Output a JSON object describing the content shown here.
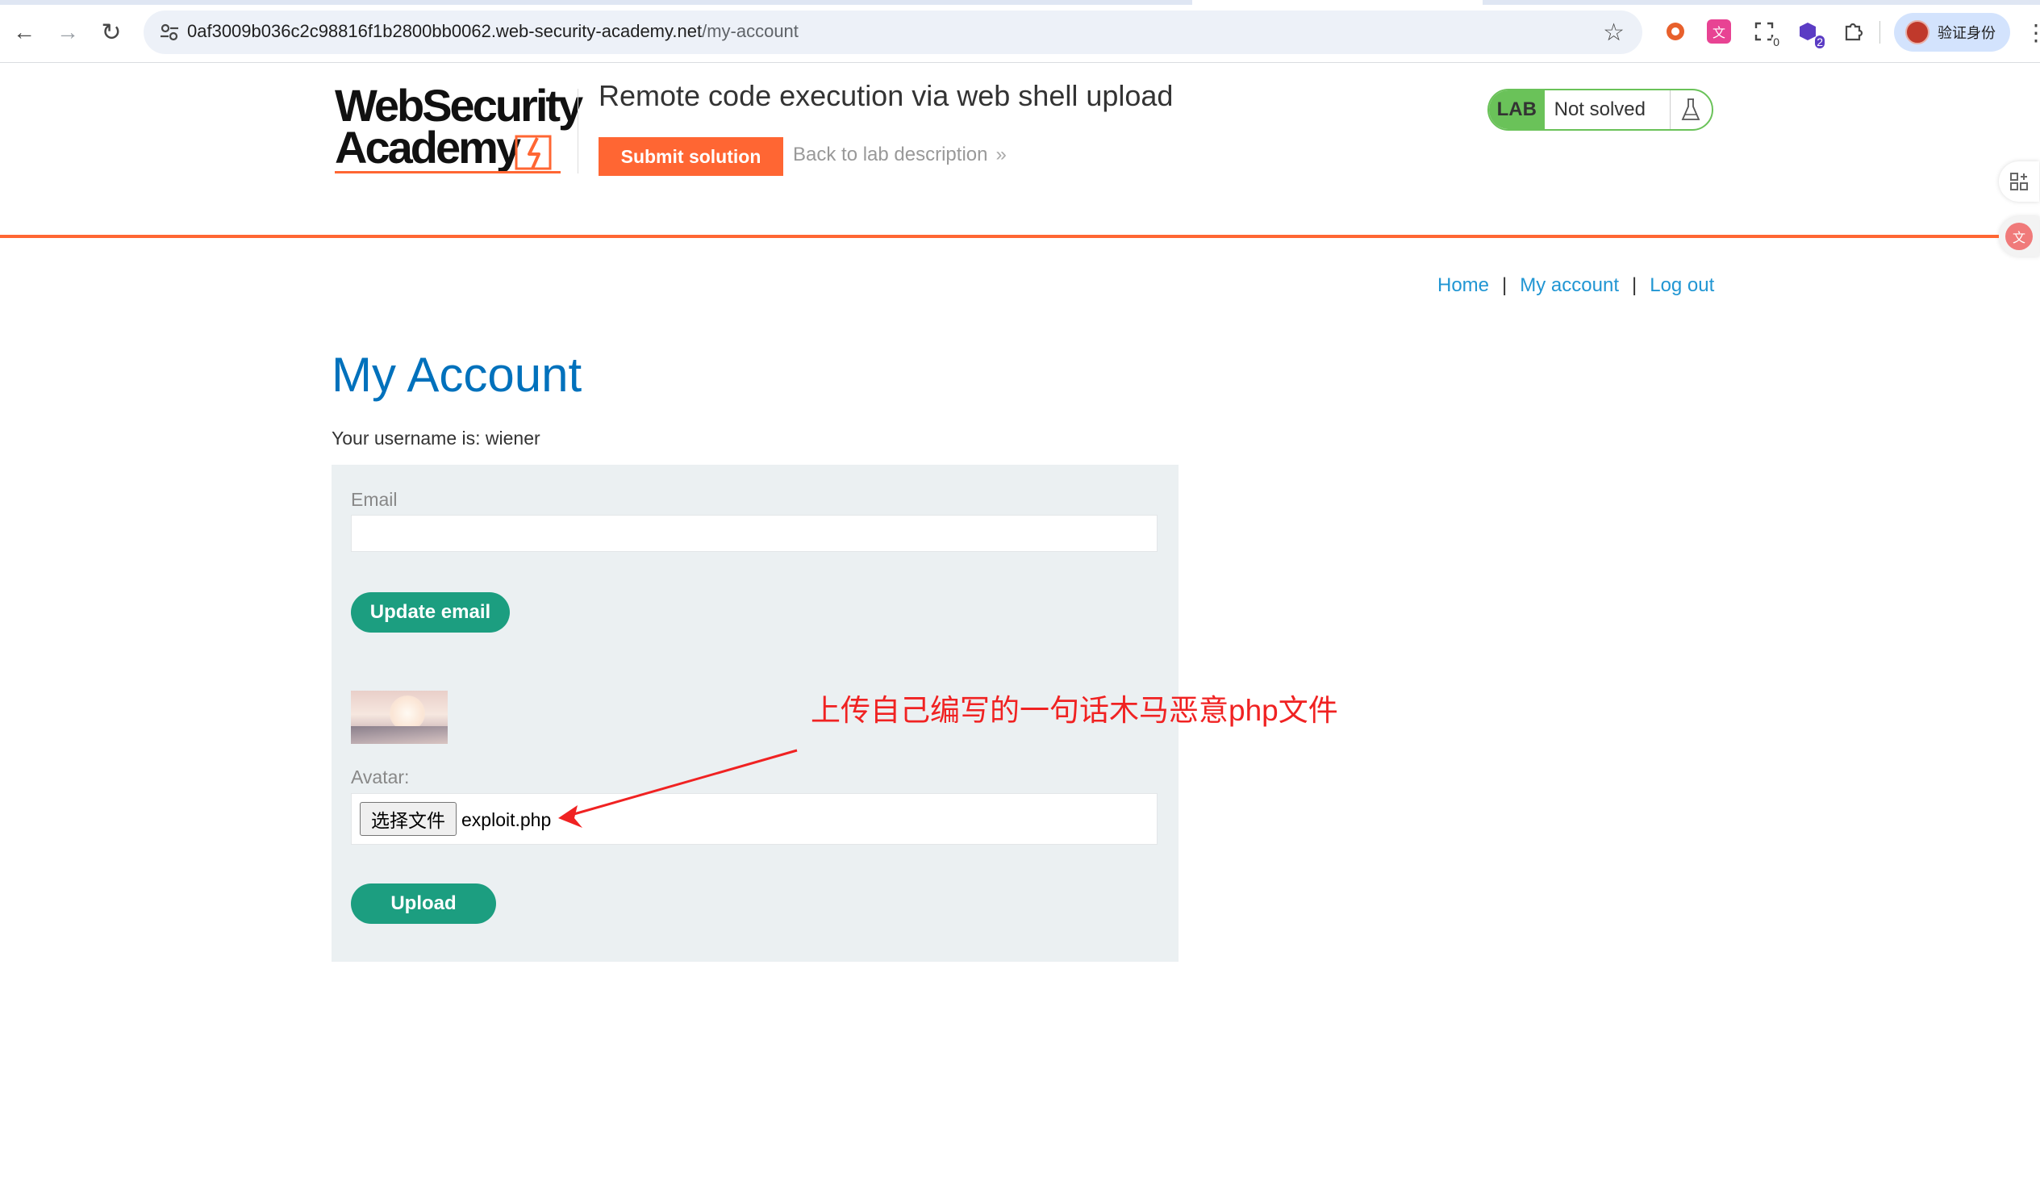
{
  "browser": {
    "url_host": "0af3009b036c2c98816f1b2800bb0062.web-security-academy.net",
    "url_path": "/my-account",
    "profile_label": "验证身份",
    "extension_badges": [
      "0",
      "2"
    ]
  },
  "header": {
    "logo_line1": "WebSecurity",
    "logo_line2": "Academy",
    "lab_title": "Remote code execution via web shell upload",
    "submit_label": "Submit solution",
    "back_label": "Back to lab description",
    "lab_tag": "LAB",
    "lab_status": "Not solved"
  },
  "nav": {
    "home": "Home",
    "separator": "|",
    "my_account": "My account",
    "log_out": "Log out"
  },
  "main": {
    "title": "My Account",
    "username_text": "Your username is: wiener",
    "email_label": "Email",
    "email_value": "",
    "update_email_label": "Update email",
    "avatar_label": "Avatar:",
    "file_button_label": "选择文件",
    "file_name": "exploit.php",
    "upload_label": "Upload"
  },
  "annotation": {
    "text": "上传自己编写的一句话木马恶意php文件",
    "color": "#f02222"
  },
  "colors": {
    "accent": "#ff6633",
    "link": "#2196d3",
    "heading": "#0071bc",
    "button": "#1c9e80",
    "lab_green": "#6ac259"
  }
}
